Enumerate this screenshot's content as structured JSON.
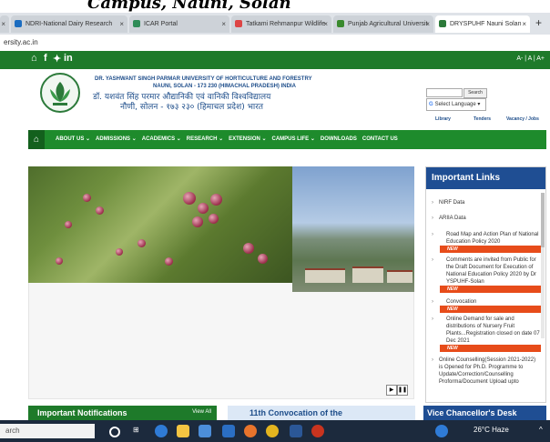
{
  "heading": "Campus, Nauni, Solan",
  "browser": {
    "tabs": [
      {
        "label": "NDRI-National Dairy Research",
        "color": "#1b6cc0"
      },
      {
        "label": "ICAR Portal",
        "color": "#2e8b57"
      },
      {
        "label": "Tatkami Rehmanpur Wildlife",
        "color": "#d44"
      },
      {
        "label": "Punjab Agricultural Universit",
        "color": "#3a8a2e"
      },
      {
        "label": "DRYSPUHF Nauni Solan",
        "color": "#2c7a3a"
      }
    ],
    "address": "ersity.ac.in"
  },
  "social": {
    "icons": [
      "home-icon",
      "facebook-icon",
      "twitter-icon",
      "linkedin-icon"
    ],
    "right": "A- | A | A+"
  },
  "header": {
    "name_en": "DR. YASHWANT SINGH PARMAR UNIVERSITY OF HORTICULTURE AND FORESTRY",
    "address_en": "NAUNI, SOLAN - 173 230 (HIMACHAL PRADESH) INDIA",
    "name_hi": "डॉ. यशवंत सिंह परमार औद्यानिकी एवं वानिकी विश्वविद्यालय",
    "address_hi": "नौणी, सोलन - १७३ २३० (हिमाचल प्रदेश) भारत",
    "search_btn": "Search",
    "language": "Select Language",
    "quick_links": [
      "Library",
      "Tenders",
      "Vacancy / Jobs"
    ]
  },
  "nav": {
    "items": [
      "ABOUT US ⌄",
      "ADMISSIONS ⌄",
      "ACADEMICS ⌄",
      "RESEARCH ⌄",
      "EXTENSION ⌄",
      "CAMPUS LIFE ⌄",
      "DOWNLOADS",
      "CONTACT US"
    ]
  },
  "links": {
    "title": "Important Links",
    "items": [
      {
        "text": "NIRF Data",
        "new": false
      },
      {
        "text": "ARIIA Data",
        "new": false
      },
      {
        "text": "Road Map and Action Plan of National Education Policy 2020",
        "new": true
      },
      {
        "text": "Comments are invited from Public for the Draft Document for Execution of National Education Policy 2020 by Dr YSPUHF-Solan",
        "new": true
      },
      {
        "text": "Convocation",
        "new": true
      },
      {
        "text": "Online Demand for sale and distributions of Nursery Fruit Plants...Registration closed on date 07 Dec 2021",
        "new": true
      },
      {
        "text": "Online Counselling(Session 2021-2022) is Opened for Ph.D. Programme to Update/Correction/Counselling Proforma/Document Upload upto",
        "new": false
      }
    ],
    "new_label": "NEW"
  },
  "sections": {
    "notifications": "Important Notifications",
    "view_all": "View All",
    "convocation": "11th Convocation of the",
    "vc_desk": "Vice Chancellor's Desk"
  },
  "taskbar": {
    "search": "arch",
    "weather": "26°C  Haze"
  }
}
